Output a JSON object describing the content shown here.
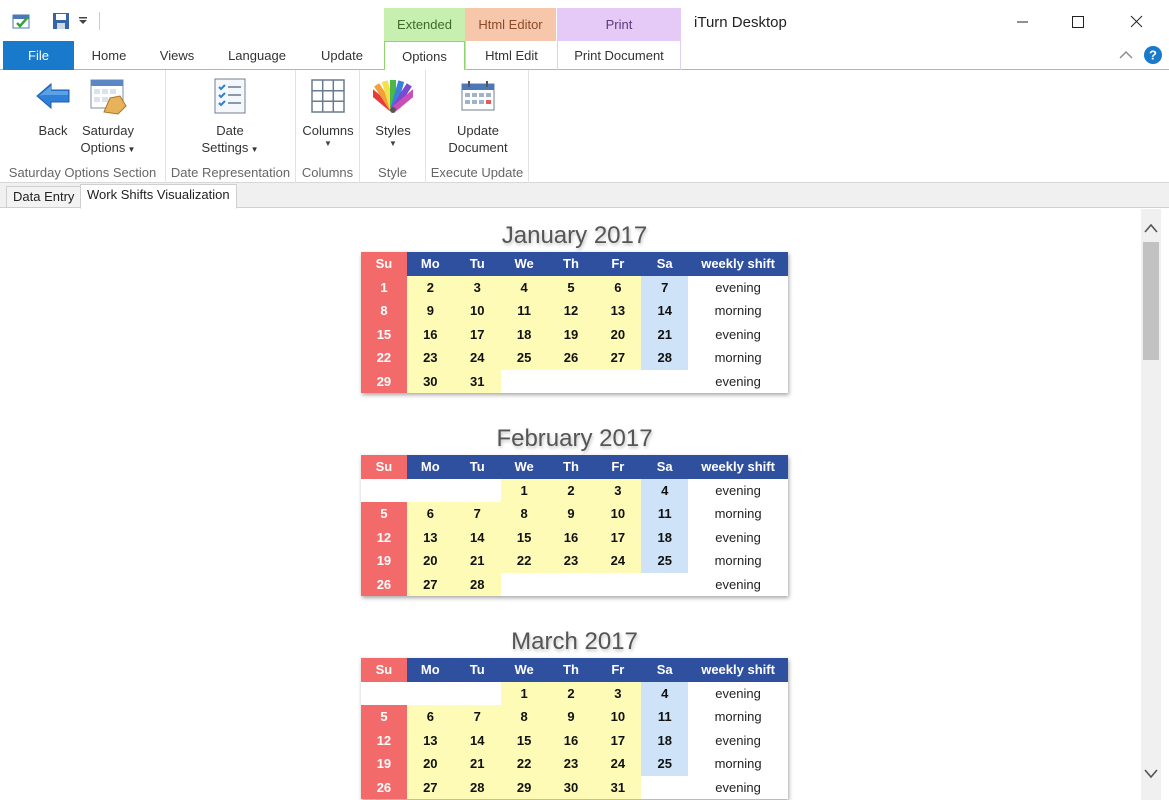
{
  "app": {
    "title": "iTurn Desktop"
  },
  "context_tabs": {
    "extended": "Extended",
    "html_editor": "Html Editor",
    "print": "Print"
  },
  "ribbon_tabs": [
    "File",
    "Home",
    "Views",
    "Language",
    "Update",
    "Options",
    "Html Edit",
    "Print Document"
  ],
  "ribbon": {
    "back": "Back",
    "saturday_options": [
      "Saturday",
      "Options"
    ],
    "date_settings": [
      "Date",
      "Settings"
    ],
    "columns": "Columns",
    "styles": "Styles",
    "update_document": [
      "Update",
      "Document"
    ],
    "groups": [
      "Saturday Options Section",
      "Date Representation",
      "Columns",
      "Style",
      "Execute Update"
    ]
  },
  "doc_tabs": [
    "Data Entry",
    "Work Shifts Visualization"
  ],
  "calendar": {
    "headers": [
      "Su",
      "Mo",
      "Tu",
      "We",
      "Th",
      "Fr",
      "Sa",
      "weekly shift"
    ],
    "months": [
      {
        "title": "January 2017",
        "weeks": [
          {
            "days": [
              "1",
              "2",
              "3",
              "4",
              "5",
              "6",
              "7"
            ],
            "shift": "evening"
          },
          {
            "days": [
              "8",
              "9",
              "10",
              "11",
              "12",
              "13",
              "14"
            ],
            "shift": "morning"
          },
          {
            "days": [
              "15",
              "16",
              "17",
              "18",
              "19",
              "20",
              "21"
            ],
            "shift": "evening"
          },
          {
            "days": [
              "22",
              "23",
              "24",
              "25",
              "26",
              "27",
              "28"
            ],
            "shift": "morning"
          },
          {
            "days": [
              "29",
              "30",
              "31",
              "",
              "",
              "",
              ""
            ],
            "shift": "evening"
          }
        ]
      },
      {
        "title": "February 2017",
        "weeks": [
          {
            "days": [
              "",
              "",
              "",
              "1",
              "2",
              "3",
              "4"
            ],
            "shift": "evening"
          },
          {
            "days": [
              "5",
              "6",
              "7",
              "8",
              "9",
              "10",
              "11"
            ],
            "shift": "morning"
          },
          {
            "days": [
              "12",
              "13",
              "14",
              "15",
              "16",
              "17",
              "18"
            ],
            "shift": "evening"
          },
          {
            "days": [
              "19",
              "20",
              "21",
              "22",
              "23",
              "24",
              "25"
            ],
            "shift": "morning"
          },
          {
            "days": [
              "26",
              "27",
              "28",
              "",
              "",
              "",
              ""
            ],
            "shift": "evening"
          }
        ]
      },
      {
        "title": "March 2017",
        "weeks": [
          {
            "days": [
              "",
              "",
              "",
              "1",
              "2",
              "3",
              "4"
            ],
            "shift": "evening"
          },
          {
            "days": [
              "5",
              "6",
              "7",
              "8",
              "9",
              "10",
              "11"
            ],
            "shift": "morning"
          },
          {
            "days": [
              "12",
              "13",
              "14",
              "15",
              "16",
              "17",
              "18"
            ],
            "shift": "evening"
          },
          {
            "days": [
              "19",
              "20",
              "21",
              "22",
              "23",
              "24",
              "25"
            ],
            "shift": "morning"
          },
          {
            "days": [
              "26",
              "27",
              "28",
              "29",
              "30",
              "31",
              ""
            ],
            "shift": "evening"
          }
        ]
      }
    ]
  },
  "colors": {
    "accent": "#1979ca",
    "header": "#2f4f9f",
    "sunday": "#f26a6a",
    "weekday": "#fdfbb6",
    "saturday": "#cfe3f8"
  }
}
